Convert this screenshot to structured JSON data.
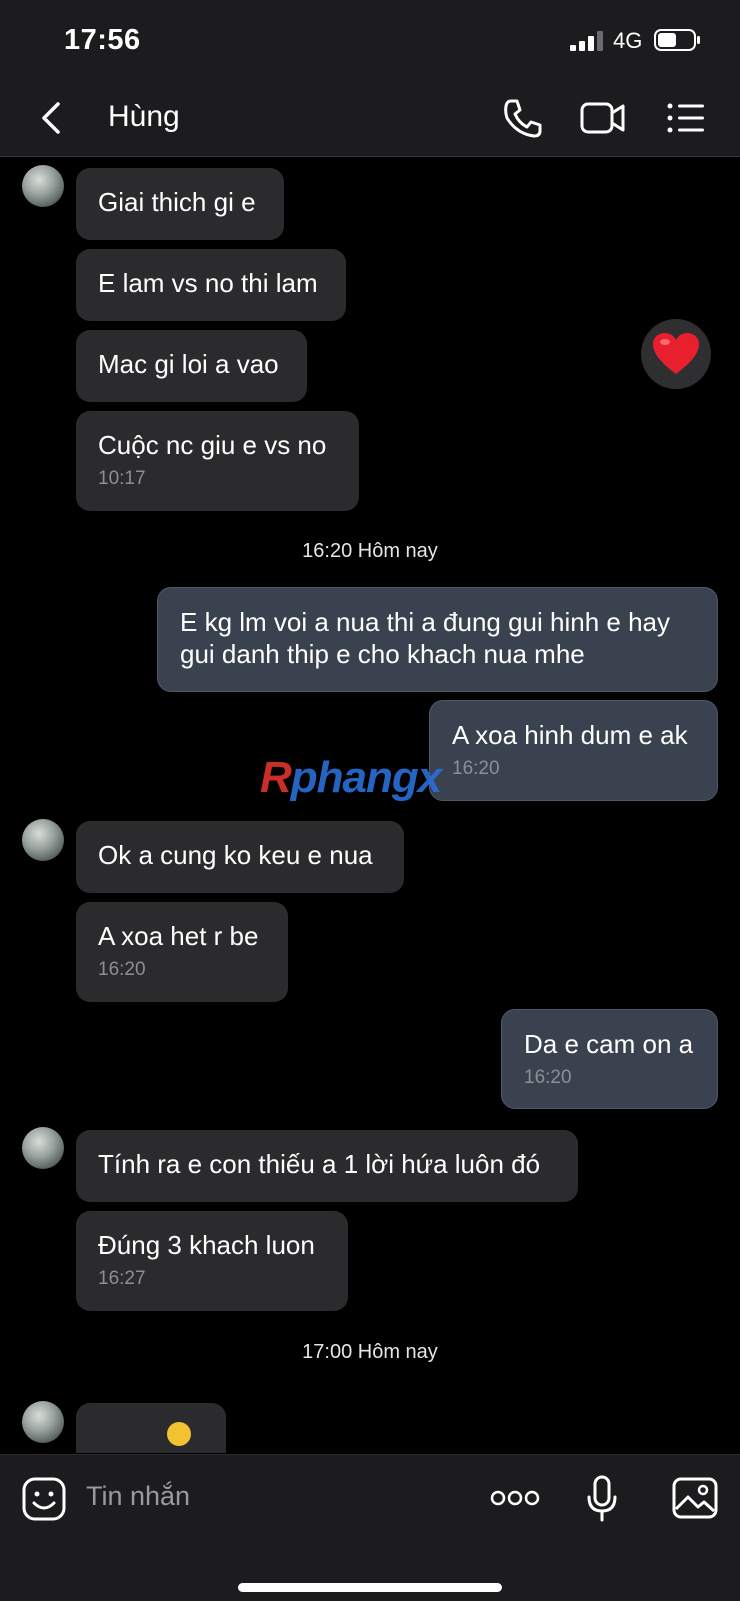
{
  "status_bar": {
    "time": "17:56",
    "network": "4G"
  },
  "header": {
    "contact_name": "Hùng"
  },
  "messages": [
    {
      "text": "Giai thich gi e"
    },
    {
      "text": "E lam vs no thi lam"
    },
    {
      "text": "Mac gi loi a vao"
    },
    {
      "text": "Cuộc nc giu e vs no",
      "time": "10:17"
    },
    {
      "text_line1": "E kg lm voi a nua thi a đung gui hinh e hay",
      "text_line2": "gui danh thip e cho khach nua mhe"
    },
    {
      "text": "A xoa hinh dum e ak",
      "time": "16:20"
    },
    {
      "text": "Ok a cung ko keu e nua"
    },
    {
      "text": "A xoa het r be",
      "time": "16:20"
    },
    {
      "text": "Da e cam on a",
      "time": "16:20"
    },
    {
      "text": "Tính ra e con thiếu a 1 lời hứa luôn đó"
    },
    {
      "text": "Đúng 3 khach luon",
      "time": "16:27"
    }
  ],
  "separators": [
    "16:20 Hôm nay",
    "17:00 Hôm nay"
  ],
  "watermark": {
    "part1": "R",
    "part2": "phangx"
  },
  "input": {
    "placeholder": "Tin nhắn"
  },
  "colors": {
    "incoming_bubble": "#2b2b2d",
    "outgoing_bubble": "#3a4250",
    "background": "#000000",
    "bars": "#1c1c1e"
  }
}
